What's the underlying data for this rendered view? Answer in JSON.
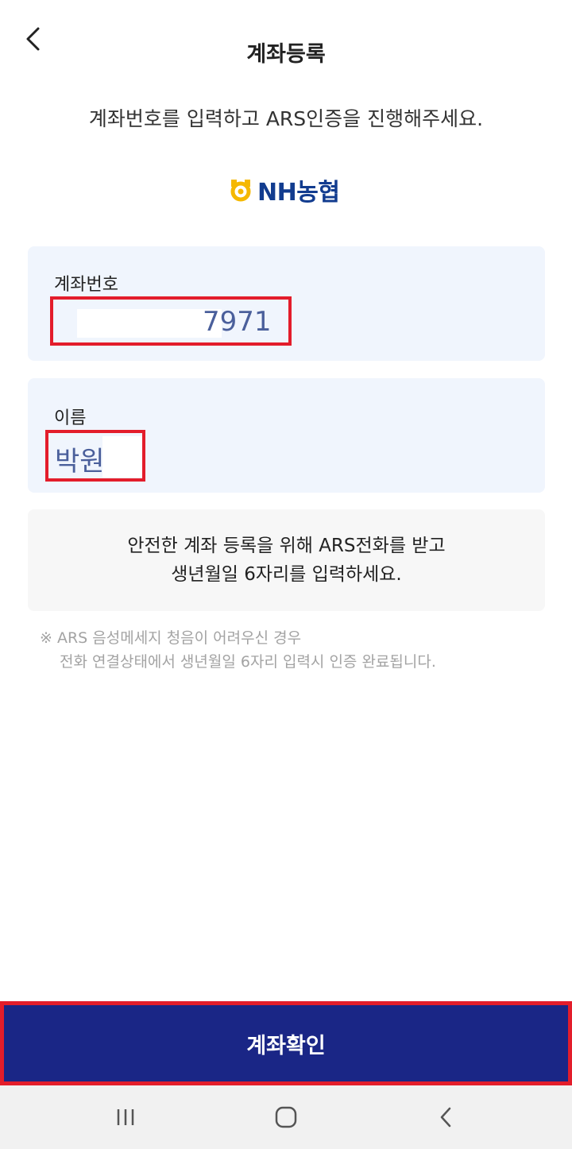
{
  "header": {
    "back_icon": "chevron-left-icon",
    "title": "계좌등록"
  },
  "instruction": "계좌번호를 입력하고 ARS인증을 진행해주세요.",
  "bank": {
    "logo_text": "NH농협",
    "logo_icon": "nh-bank-logo-icon",
    "brand_color": "#123c8f",
    "mark_color": "#f5b800"
  },
  "account_field": {
    "label": "계좌번호",
    "value_visible": "7971"
  },
  "name_field": {
    "label": "이름",
    "value_visible": "박원"
  },
  "info": {
    "line1": "안전한 계좌 등록을 위해 ARS전화를 받고",
    "line2": "생년월일 6자리를 입력하세요."
  },
  "notice": {
    "line1": "※ ARS 음성메세지 청음이 어려우신 경우",
    "line2": "전화 연결상태에서 생년월일 6자리 입력시 인증 완료됩니다."
  },
  "confirm_button": {
    "label": "계좌확인",
    "color": "#1a2686"
  },
  "highlight_color": "#e31d2b",
  "navbar": {
    "recent_icon": "recent-apps-icon",
    "home_icon": "home-icon",
    "back_icon": "back-icon"
  }
}
